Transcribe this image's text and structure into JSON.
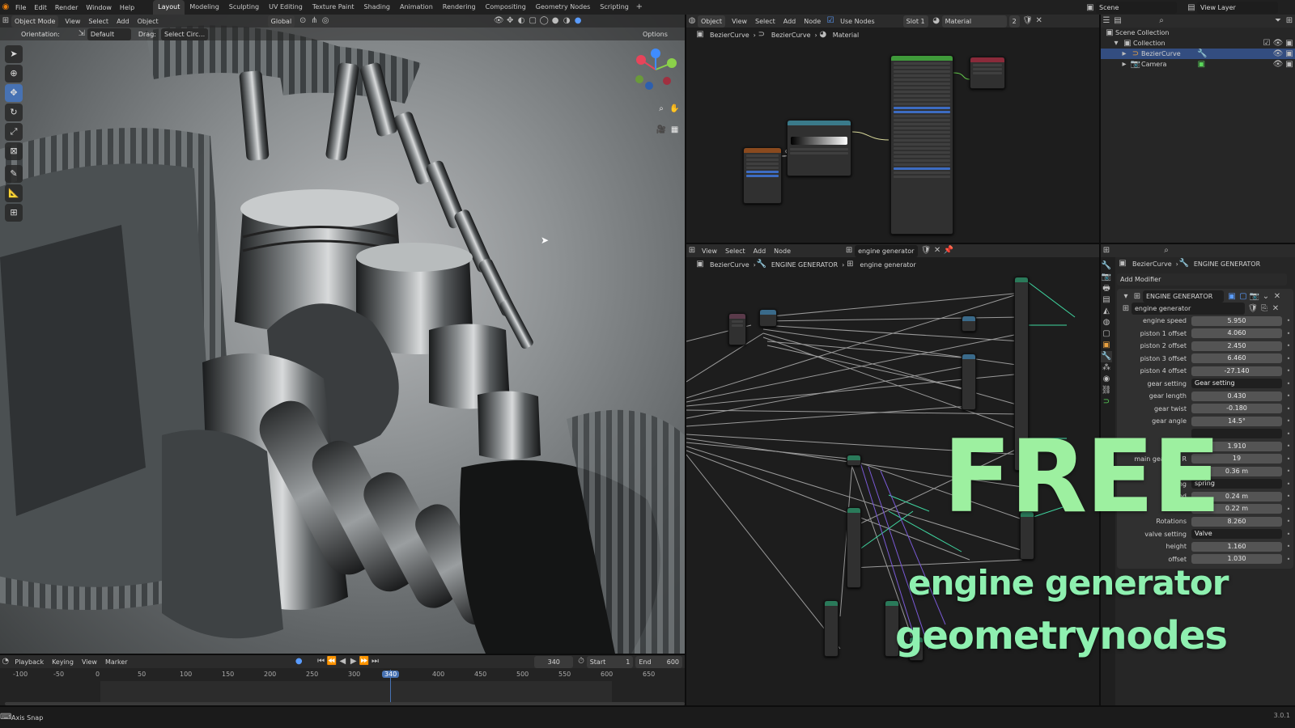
{
  "menu": [
    "File",
    "Edit",
    "Render",
    "Window",
    "Help"
  ],
  "workspaces": [
    "Layout",
    "Modeling",
    "Sculpting",
    "UV Editing",
    "Texture Paint",
    "Shading",
    "Animation",
    "Rendering",
    "Compositing",
    "Geometry Nodes",
    "Scripting"
  ],
  "active_workspace": "Layout",
  "scene": "Scene",
  "view_layer": "View Layer",
  "viewport": {
    "mode": "Object Mode",
    "menus": [
      "View",
      "Select",
      "Add",
      "Object"
    ],
    "transform": "Global",
    "orientation_label": "Orientation:",
    "orientation_value": "Default",
    "drag_label": "Drag:",
    "drag_value": "Select Circ...",
    "options": "Options"
  },
  "shader_editor": {
    "object_type": "Object",
    "menus": [
      "View",
      "Select",
      "Add",
      "Node"
    ],
    "use_nodes": "Use Nodes",
    "slot": "Slot 1",
    "material": "Material",
    "users": "2",
    "breadcrumb": [
      "BezierCurve",
      "BezierCurve",
      "Material"
    ]
  },
  "geo_editor": {
    "menus": [
      "View",
      "Select",
      "Add",
      "Node"
    ],
    "tree": "engine generator",
    "breadcrumb": [
      "BezierCurve",
      "ENGINE GENERATOR",
      "engine generator"
    ]
  },
  "outliner": {
    "root": "Scene Collection",
    "collection": "Collection",
    "items": [
      "BezierCurve",
      "Camera"
    ]
  },
  "properties": {
    "breadcrumb": [
      "BezierCurve",
      "ENGINE GENERATOR"
    ],
    "add_modifier": "Add Modifier",
    "modifier_name": "ENGINE GENERATOR",
    "node_group": "engine generator",
    "rows": [
      {
        "label": "engine speed",
        "value": "5.950"
      },
      {
        "label": "piston 1 offset",
        "value": "4.060"
      },
      {
        "label": "piston 2 offset",
        "value": "2.450"
      },
      {
        "label": "piston 3 offset",
        "value": "6.460"
      },
      {
        "label": "piston 4 offset",
        "value": "-27.140"
      },
      {
        "label": "gear setting",
        "value": "Gear setting"
      },
      {
        "label": "gear length",
        "value": "0.430"
      },
      {
        "label": "gear twist",
        "value": "-0.180"
      },
      {
        "label": "gear angle",
        "value": "14.5°"
      },
      {
        "label": "",
        "value": ""
      },
      {
        "label": "main g",
        "value": "1.910"
      },
      {
        "label": "main gear bar R",
        "value": "19"
      },
      {
        "label": "gear ba",
        "value": "0.36 m"
      },
      {
        "label": "spring",
        "value": "spring"
      },
      {
        "label": "End",
        "value": "0.24 m"
      },
      {
        "label": "Start",
        "value": "0.22 m"
      },
      {
        "label": "Rotations",
        "value": "8.260"
      },
      {
        "label": "valve setting",
        "value": "Valve"
      },
      {
        "label": "height",
        "value": "1.160"
      },
      {
        "label": "offset",
        "value": "1.030"
      }
    ]
  },
  "timeline": {
    "menus": [
      "Playback",
      "Keying",
      "View",
      "Marker"
    ],
    "current_frame": "340",
    "start_label": "Start",
    "start": "1",
    "end_label": "End",
    "end": "600",
    "ticks": [
      "-100",
      "-50",
      "0",
      "50",
      "100",
      "150",
      "200",
      "250",
      "300",
      "340",
      "400",
      "450",
      "500",
      "550",
      "600",
      "650"
    ]
  },
  "status": {
    "hint": "Axis Snap",
    "version": "3.0.1"
  },
  "overlay": {
    "title": "FREE",
    "line1": "engine generator",
    "line2": "geometrynodes"
  }
}
